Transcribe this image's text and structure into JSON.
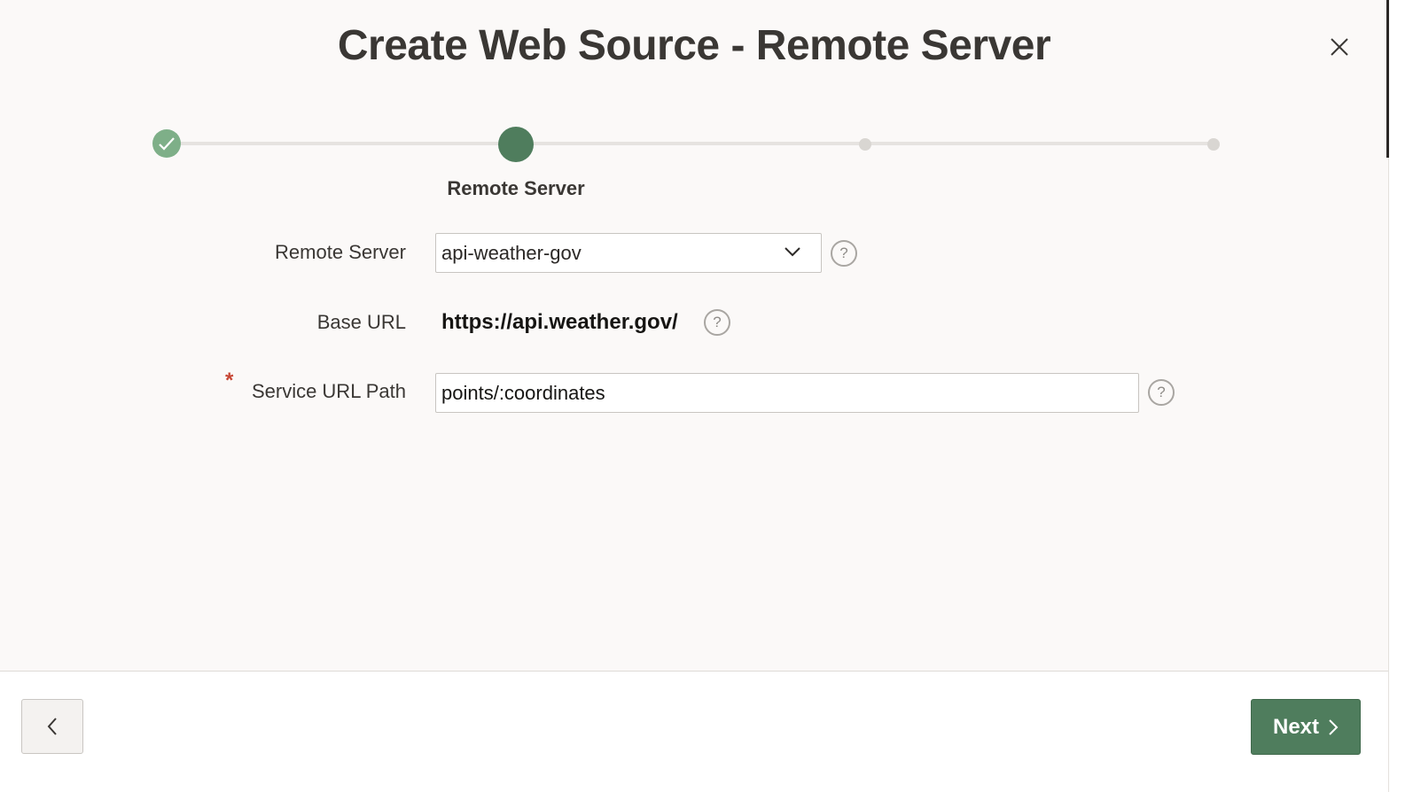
{
  "dialog": {
    "title": "Create Web Source - Remote Server",
    "close_icon": "close-icon"
  },
  "progress": {
    "current_step_label": "Remote Server",
    "steps": [
      {
        "state": "complete",
        "icon": "check-icon"
      },
      {
        "state": "current"
      },
      {
        "state": "upcoming"
      },
      {
        "state": "upcoming"
      }
    ],
    "colors": {
      "complete": "#7eaf88",
      "current": "#4f7d5d",
      "upcoming": "#d9d6d2"
    }
  },
  "form": {
    "remote_server": {
      "label": "Remote Server",
      "value": "api-weather-gov",
      "icon": "chevron-down-icon"
    },
    "base_url": {
      "label": "Base URL",
      "value": "https://api.weather.gov/"
    },
    "service_url_path": {
      "label": "Service URL Path",
      "value": "points/:coordinates",
      "required_marker": "*"
    },
    "help_glyph": "?"
  },
  "footer": {
    "previous_icon": "chevron-left-icon",
    "next_label": "Next",
    "next_icon": "chevron-right-icon"
  },
  "colors": {
    "accent": "#4f7d5d",
    "required": "#c74634",
    "background": "#fbf9f8"
  }
}
